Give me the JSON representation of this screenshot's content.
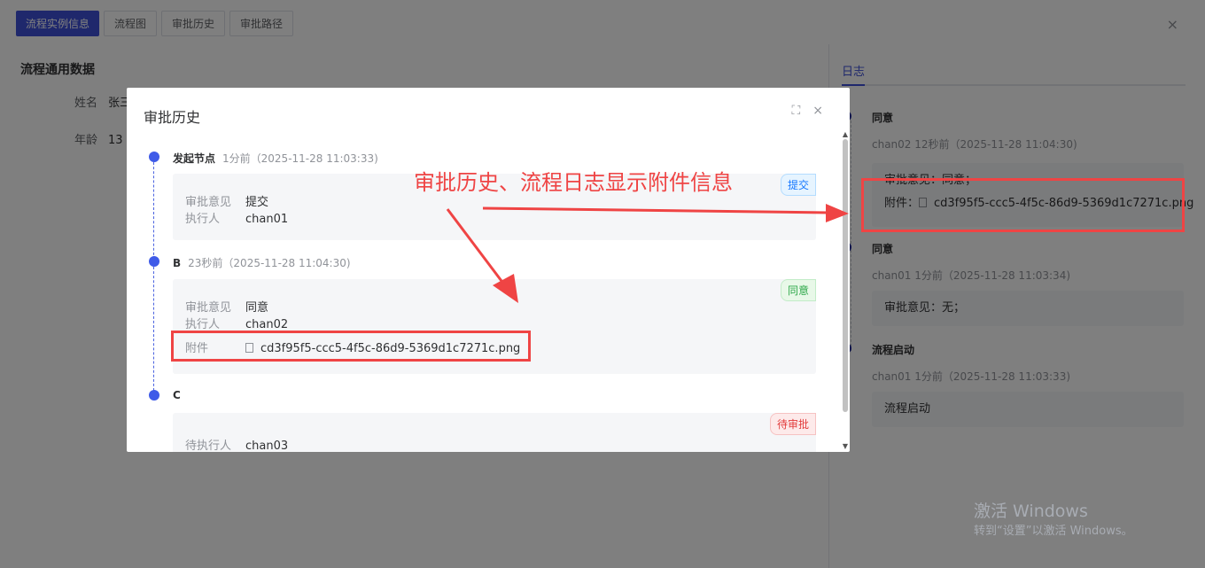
{
  "toolbar": {
    "tabs": [
      "流程实例信息",
      "流程图",
      "审批历史",
      "审批路径"
    ],
    "close": "×"
  },
  "form": {
    "section_title": "流程通用数据",
    "name_label": "姓名",
    "name_value": "张三",
    "age_label": "年龄",
    "age_value": "13"
  },
  "log_panel": {
    "tab": "日志",
    "items": [
      {
        "title": "同意",
        "meta": "chan02 12秒前（2025-11-28 11:04:30)",
        "opinion": "审批意见：同意；",
        "attach_label": "附件：",
        "attach_file": "cd3f95f5-ccc5-4f5c-86d9-5369d1c7271c.png"
      },
      {
        "title": "同意",
        "meta": "chan01 1分前（2025-11-28 11:03:34)",
        "opinion": "审批意见：无；"
      },
      {
        "title": "流程启动",
        "meta": "chan01 1分前（2025-11-28 11:03:33)",
        "opinion": "流程启动"
      }
    ]
  },
  "dialog": {
    "title": "审批历史",
    "fullscreen_icon": "⛶",
    "close_icon": "×",
    "nodes": [
      {
        "name": "发起节点",
        "ago": "1分前（2025-11-28 11:03:33)",
        "tag": "提交",
        "opinion_label": "审批意见",
        "opinion": "提交",
        "executor_label": "执行人",
        "executor": "chan01"
      },
      {
        "name": "B",
        "ago": "23秒前（2025-11-28 11:04:30)",
        "tag": "同意",
        "opinion_label": "审批意见",
        "opinion": "同意",
        "executor_label": "执行人",
        "executor": "chan02",
        "attach_label": "附件",
        "attach_file": "cd3f95f5-ccc5-4f5c-86d9-5369d1c7271c.png"
      },
      {
        "name": "C",
        "tag": "待审批",
        "executor_label": "待执行人",
        "executor": "chan03"
      }
    ]
  },
  "annotation": {
    "text": "审批历史、流程日志显示附件信息",
    "color": "#ef4444"
  },
  "watermark": {
    "line1": "激活 Windows",
    "line2": "转到“设置”以激活 Windows。"
  }
}
